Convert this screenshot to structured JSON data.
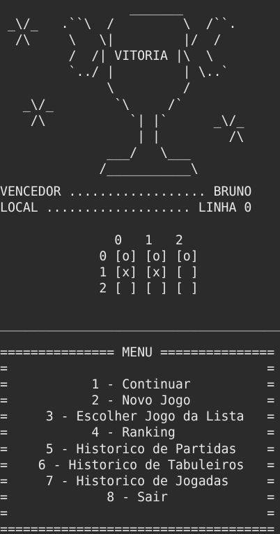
{
  "trophy_art": [
    "                 _______",
    " _\\/_   .``\\  /         \\  /``.",
    "  /\\     \\   \\|         |/  /",
    "         /  /| VITORIA |\\  \\",
    "         `../ |         | \\..`",
    "              \\         /",
    "   _\\/_        `\\     /`",
    "    /\\           `| |`      _\\/_",
    "                  | |         /\\",
    "              ___/   \\___",
    "             /___________\\"
  ],
  "result": {
    "winner_line": "VENCEDOR .................. BRUNO",
    "location_line": "LOCAL ................... LINHA 0"
  },
  "board": {
    "header": "               0   1   2",
    "rows": [
      "             0 [o] [o] [o]",
      "             1 [x] [x] [ ]",
      "             2 [ ] [ ] [ ]"
    ]
  },
  "divider": "________________________________________",
  "menu": {
    "title_line": "=============== MENU ===============",
    "blank_line": "=                                  =",
    "items": [
      "=           1 - Continuar          =",
      "=           2 - Novo Jogo          =",
      "=     3 - Escolher Jogo da Lista   =",
      "=           4 - Ranking            =",
      "=     5 - Historico de Partidas    =",
      "=    6 - Historico de Tabuleiros   =",
      "=     7 - Historico de Jogadas     =",
      "=             8 - Sair             ="
    ],
    "bottom_line": "===================================="
  }
}
